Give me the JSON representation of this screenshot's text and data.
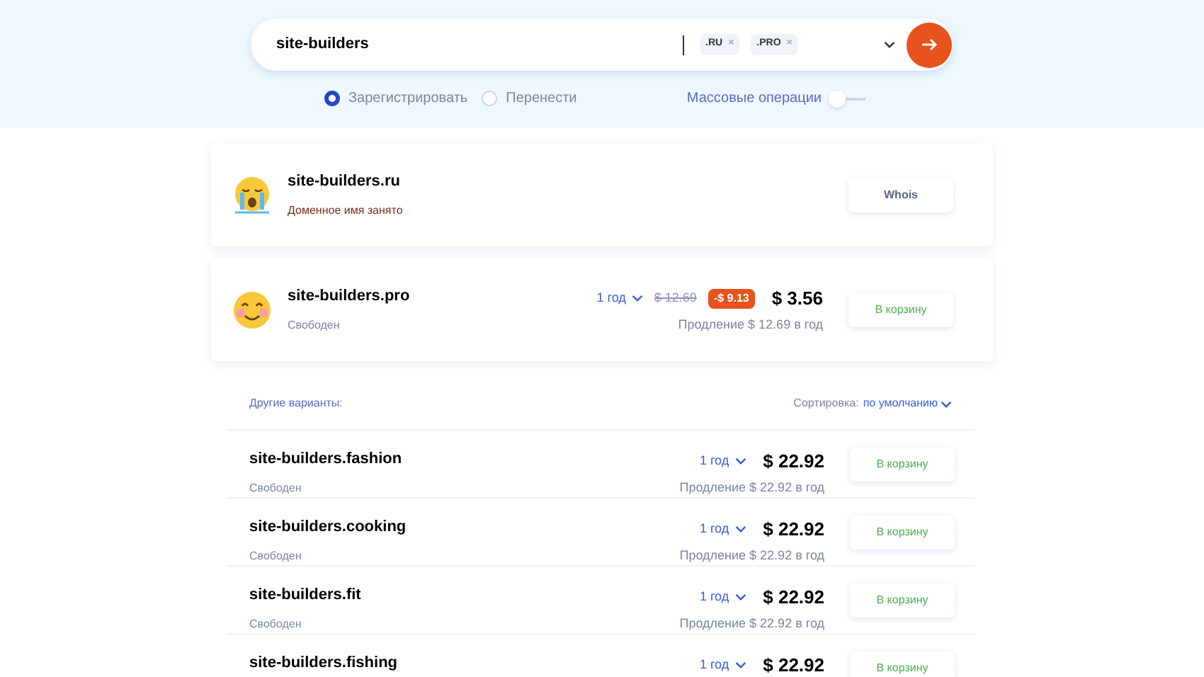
{
  "search": {
    "query": "site-builders",
    "tlds": [
      {
        "label": ".RU",
        "remove": "×"
      },
      {
        "label": ".PRO",
        "remove": "×"
      }
    ]
  },
  "modes": [
    {
      "label": "Зарегистрировать",
      "selected": true
    },
    {
      "label": "Перенести",
      "selected": false
    }
  ],
  "bulk": {
    "label": "Массовые операции",
    "on": false
  },
  "results": [
    {
      "kind": "taken",
      "domain": "site-builders.ru",
      "status": "Доменное имя занято",
      "button": "Whois"
    },
    {
      "kind": "free",
      "domain": "site-builders.pro",
      "status": "Свободен",
      "period": "1 год",
      "old_price": "$ 12.69",
      "discount": "-$ 9.13",
      "price": "$ 3.56",
      "renewal": "Продление $ 12.69 в год",
      "button": "В корзину"
    }
  ],
  "others": {
    "label": "Другие варианты:",
    "sort_label": "Сортировка:",
    "sort_value": "по умолчанию",
    "rows": [
      {
        "domain": "site-builders.fashion",
        "status": "Свободен",
        "period": "1 год",
        "price": "$ 22.92",
        "renewal": "Продление $ 22.92 в год",
        "button": "В корзину"
      },
      {
        "domain": "site-builders.cooking",
        "status": "Свободен",
        "period": "1 год",
        "price": "$ 22.92",
        "renewal": "Продление $ 22.92 в год",
        "button": "В корзину"
      },
      {
        "domain": "site-builders.fit",
        "status": "Свободен",
        "period": "1 год",
        "price": "$ 22.92",
        "renewal": "Продление $ 22.92 в год",
        "button": "В корзину"
      },
      {
        "domain": "site-builders.fishing",
        "period": "1 год",
        "price": "$ 22.92",
        "button": "В корзину"
      }
    ]
  }
}
